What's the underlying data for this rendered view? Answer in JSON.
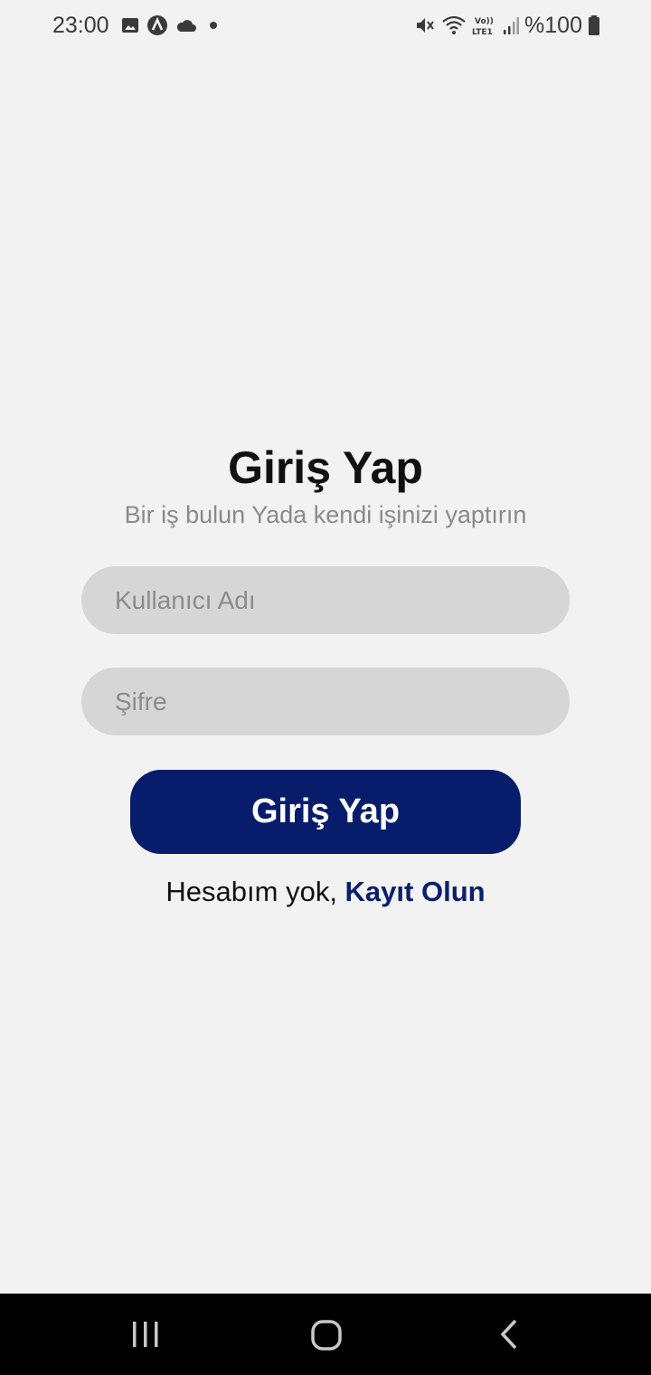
{
  "status_bar": {
    "time": "23:00",
    "left_icons": [
      "image-icon",
      "app-icon",
      "cloud-icon",
      "dot-icon"
    ],
    "right_icons": [
      "mute-icon",
      "wifi-icon",
      "volte-lte-icon",
      "signal-icon"
    ],
    "battery_text": "%100"
  },
  "login": {
    "title": "Giriş Yap",
    "subtitle": "Bir iş bulun Yada kendi işinizi yaptırın",
    "username_placeholder": "Kullanıcı Adı",
    "username_value": "",
    "password_placeholder": "Şifre",
    "password_value": "",
    "submit_label": "Giriş Yap",
    "no_account_text": "Hesabım yok, ",
    "register_link": "Kayıt Olun"
  },
  "colors": {
    "background": "#f2f2f2",
    "input_bg": "#d6d6d6",
    "primary": "#071c6b",
    "subtitle": "#8a8a8a"
  },
  "nav_bar": {
    "buttons": [
      "recents-icon",
      "home-icon",
      "back-icon"
    ]
  }
}
